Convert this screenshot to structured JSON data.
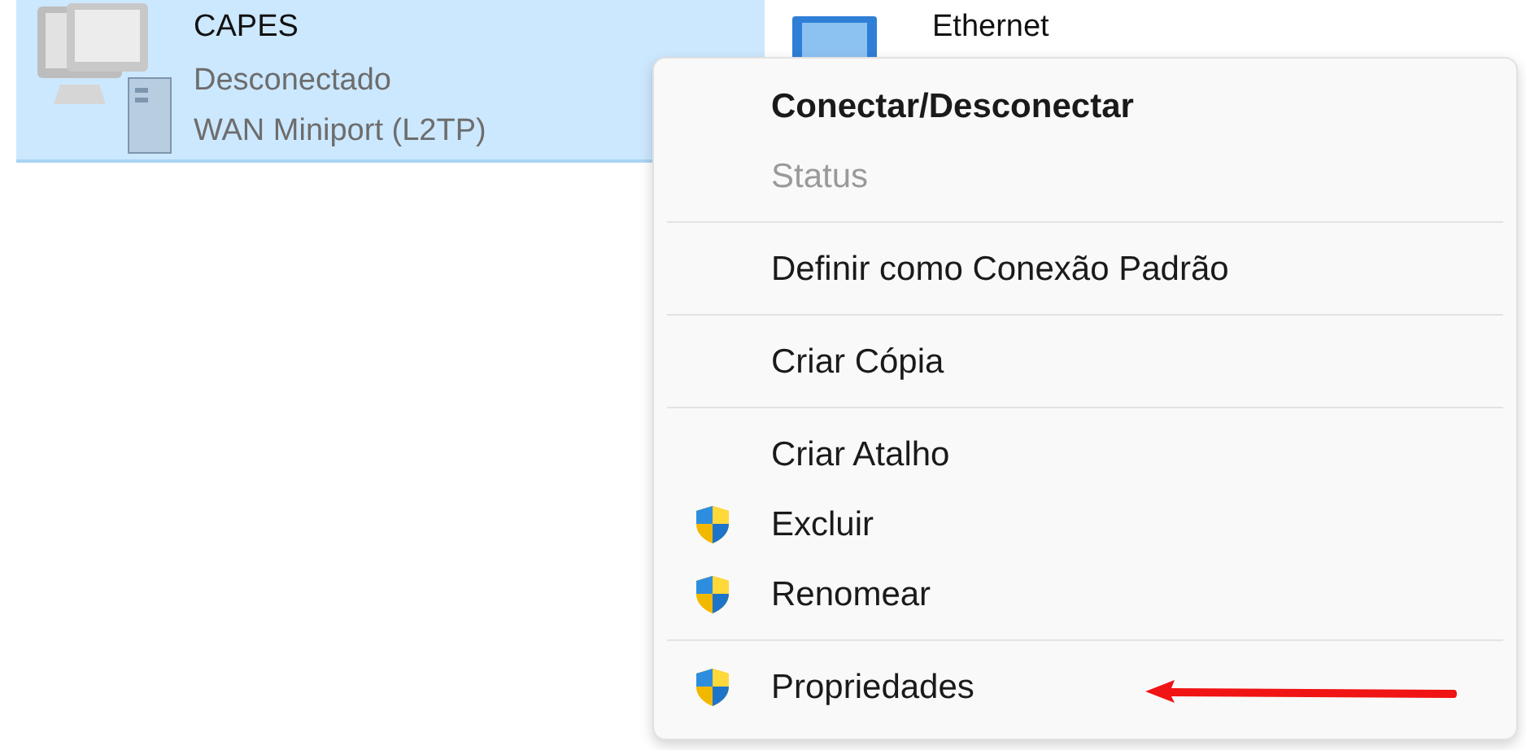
{
  "connections": [
    {
      "name": "CAPES",
      "status": "Desconectado",
      "device": "WAN Miniport (L2TP)",
      "selected": true
    },
    {
      "name": "Ethernet",
      "selected": false
    }
  ],
  "context_menu": {
    "items": [
      {
        "kind": "item",
        "label": "Conectar/Desconectar",
        "default": true,
        "disabled": false
      },
      {
        "kind": "item",
        "label": "Status",
        "default": false,
        "disabled": true
      },
      {
        "kind": "separator"
      },
      {
        "kind": "item",
        "label": "Definir como Conexão Padrão",
        "default": false,
        "disabled": false
      },
      {
        "kind": "separator"
      },
      {
        "kind": "item",
        "label": "Criar Cópia",
        "default": false,
        "disabled": false
      },
      {
        "kind": "separator"
      },
      {
        "kind": "item",
        "label": "Criar Atalho",
        "default": false,
        "disabled": false
      },
      {
        "kind": "shield",
        "label": "Excluir",
        "default": false,
        "disabled": false
      },
      {
        "kind": "shield",
        "label": "Renomear",
        "default": false,
        "disabled": false
      },
      {
        "kind": "separator"
      },
      {
        "kind": "shield",
        "label": "Propriedades",
        "default": false,
        "disabled": false
      }
    ]
  },
  "annotations": [
    {
      "kind": "arrow"
    }
  ]
}
